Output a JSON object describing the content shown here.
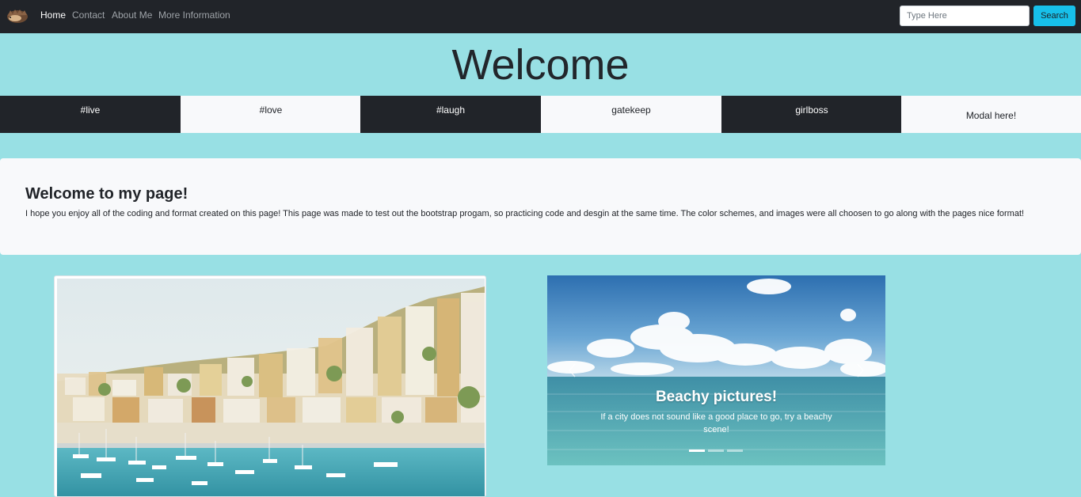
{
  "navbar": {
    "logo_icon": "hedgehog-logo-icon",
    "links": [
      {
        "label": "Home",
        "active": true
      },
      {
        "label": "Contact",
        "active": false
      },
      {
        "label": "About Me",
        "active": false
      },
      {
        "label": "More Information",
        "active": false
      }
    ],
    "search": {
      "placeholder": "Type Here",
      "value": "",
      "button_label": "Search"
    }
  },
  "hero": {
    "title": "Welcome"
  },
  "tags": [
    {
      "label": "#live"
    },
    {
      "label": "#love"
    },
    {
      "label": "#laugh"
    },
    {
      "label": "gatekeep"
    },
    {
      "label": "girlboss"
    }
  ],
  "modal_button": {
    "label": "Modal here!"
  },
  "jumbotron": {
    "heading": "Welcome to my page!",
    "text": "I hope you enjoy all of the coding and format created on this page! This page was made to test out the bootstrap progam, so practicing code and desgin at the same time. The color schemes, and images were all choosen to go along with the pages nice format!"
  },
  "carousel": {
    "caption_title": "Beachy pictures!",
    "caption_text": "If a city does not sound like a good place to go, try a beachy scene!",
    "prev_icon": "chevron-left-icon",
    "next_icon": "chevron-right-icon",
    "slides": 3,
    "active_slide": 1
  },
  "colors": {
    "page_bg": "#98e0e4",
    "navbar_bg": "#212429",
    "accent": "#17c0ea",
    "light_tile": "#f8f9fb"
  }
}
